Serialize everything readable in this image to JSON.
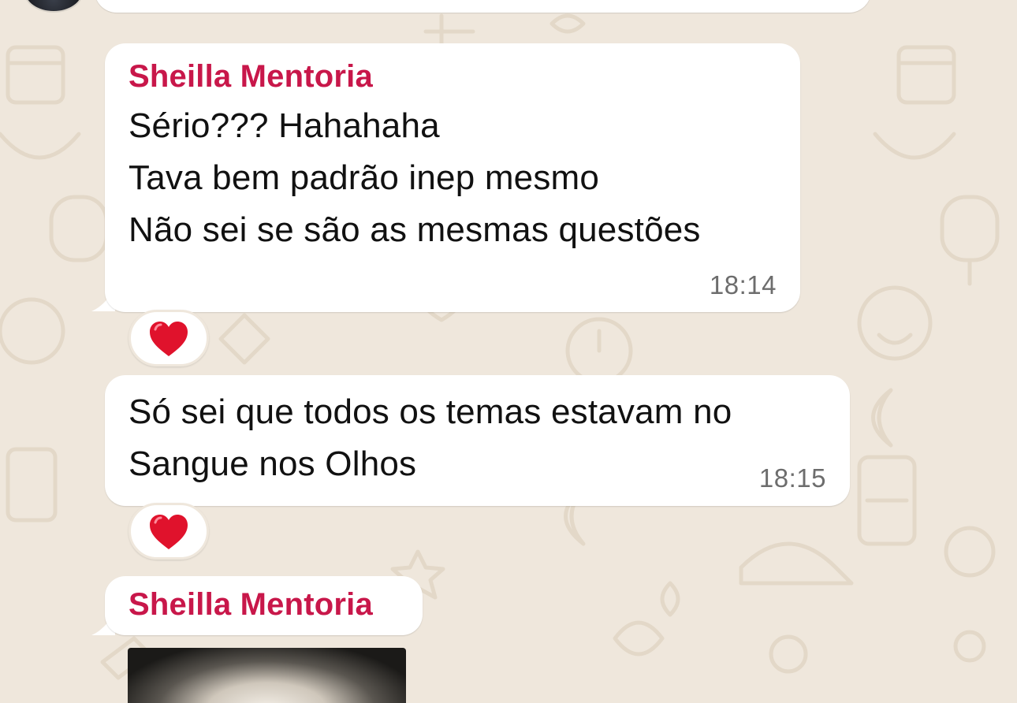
{
  "chat": {
    "messages": [
      {
        "sender": "Sheilla Mentoria",
        "lines": [
          "Sério??? Hahahaha",
          "Tava bem padrão inep mesmo",
          "Não sei se são as mesmas questões"
        ],
        "time": "18:14",
        "reaction": "❤️"
      },
      {
        "lines": [
          "Só sei que todos os temas estavam no",
          "Sangue nos Olhos"
        ],
        "time": "18:15",
        "reaction": "❤️"
      },
      {
        "sender": "Sheilla Mentoria",
        "attachment": "photo"
      }
    ]
  },
  "colors": {
    "sender_name": "#c8174a",
    "wallpaper": "#efe7dc",
    "bubble": "#ffffff",
    "reaction_heart": "#e0122c"
  },
  "icons": {
    "reaction": "red-heart-icon"
  }
}
